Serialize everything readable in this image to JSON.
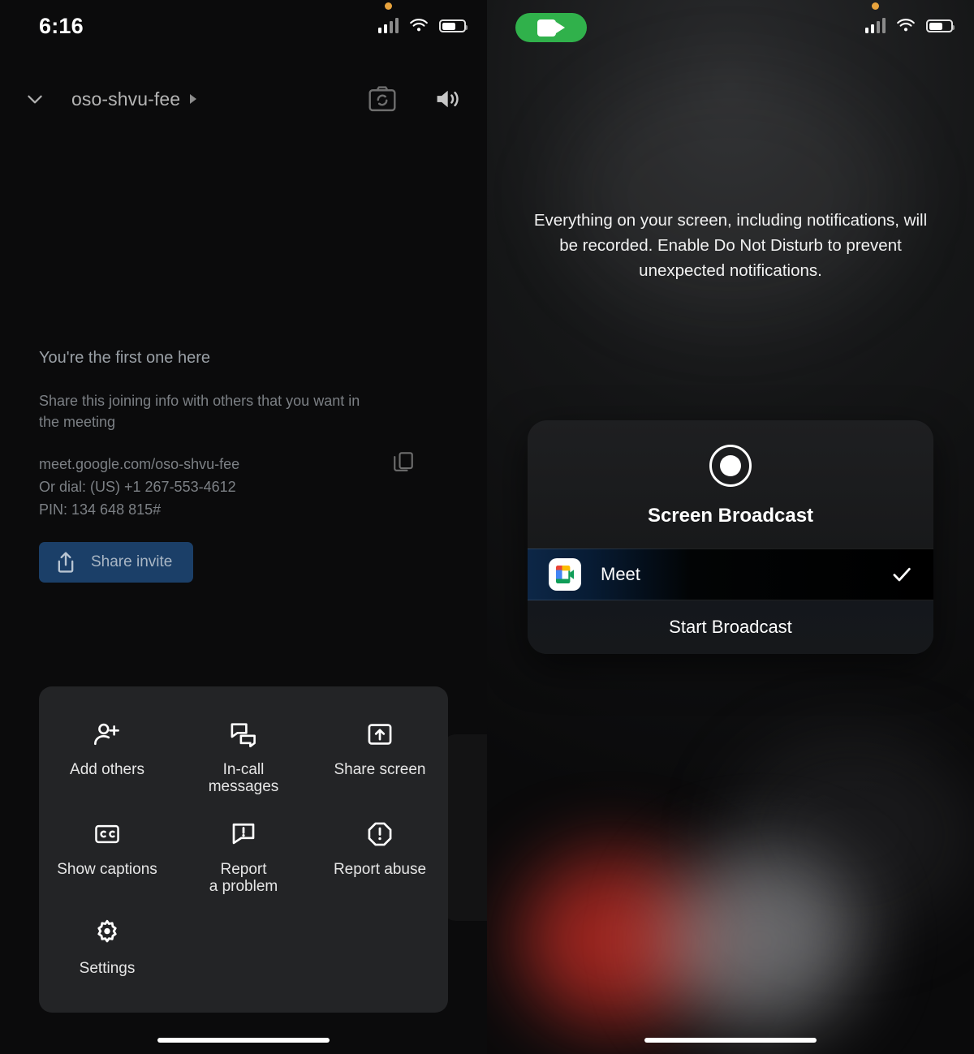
{
  "left_panel": {
    "statusbar": {
      "time": "6:16",
      "icons": [
        "cellular-signal-icon",
        "wifi-icon",
        "battery-icon"
      ],
      "privacy_dot": "orange-recording-dot"
    },
    "header": {
      "collapse_icon": "chevron-down-icon",
      "meeting_code": "oso-shvu-fee",
      "expand_icon": "triangle-right-icon",
      "switch_camera_icon": "camera-flip-icon",
      "speaker_icon": "speaker-volume-icon"
    },
    "info": {
      "heading": "You're the first one here",
      "subtext": "Share this joining info with others that you want in the meeting",
      "meeting_link": "meet.google.com/oso-shvu-fee",
      "dial_in": "Or dial: (US) +1 267-553-4612",
      "pin": "PIN: 134 648 815#",
      "copy_icon": "copy-icon"
    },
    "share_invite": {
      "label": "Share invite",
      "icon": "share-upload-icon",
      "color": "#1b3f68"
    },
    "sheet_items": [
      {
        "label": "Add others",
        "icon": "person-add-icon"
      },
      {
        "label": "In-call\nmessages",
        "icon": "chat-bubbles-icon"
      },
      {
        "label": "Share screen",
        "icon": "screen-share-arrow-up-icon"
      },
      {
        "label": "Show captions",
        "icon": "closed-captions-icon"
      },
      {
        "label": "Report\na problem",
        "icon": "report-problem-bubble-icon"
      },
      {
        "label": "Report abuse",
        "icon": "report-abuse-octagon-icon"
      },
      {
        "label": "Settings",
        "icon": "gear-icon"
      }
    ]
  },
  "right_panel": {
    "statusbar": {
      "recording_pill_icon": "video-camera-icon",
      "recording_pill_color": "#30b14b",
      "icons": [
        "cellular-signal-icon",
        "wifi-icon",
        "battery-icon"
      ],
      "privacy_dot": "orange-recording-dot"
    },
    "warning": "Everything on your screen, including notifications, will be recorded. Enable Do Not Disturb to prevent unexpected notifications.",
    "broadcast_card": {
      "record_icon": "record-circle-icon",
      "title": "Screen Broadcast",
      "app_row": {
        "app_name": "Meet",
        "app_icon": "google-meet-icon",
        "selected": true,
        "check_icon": "checkmark-icon"
      },
      "start_label": "Start Broadcast"
    }
  }
}
